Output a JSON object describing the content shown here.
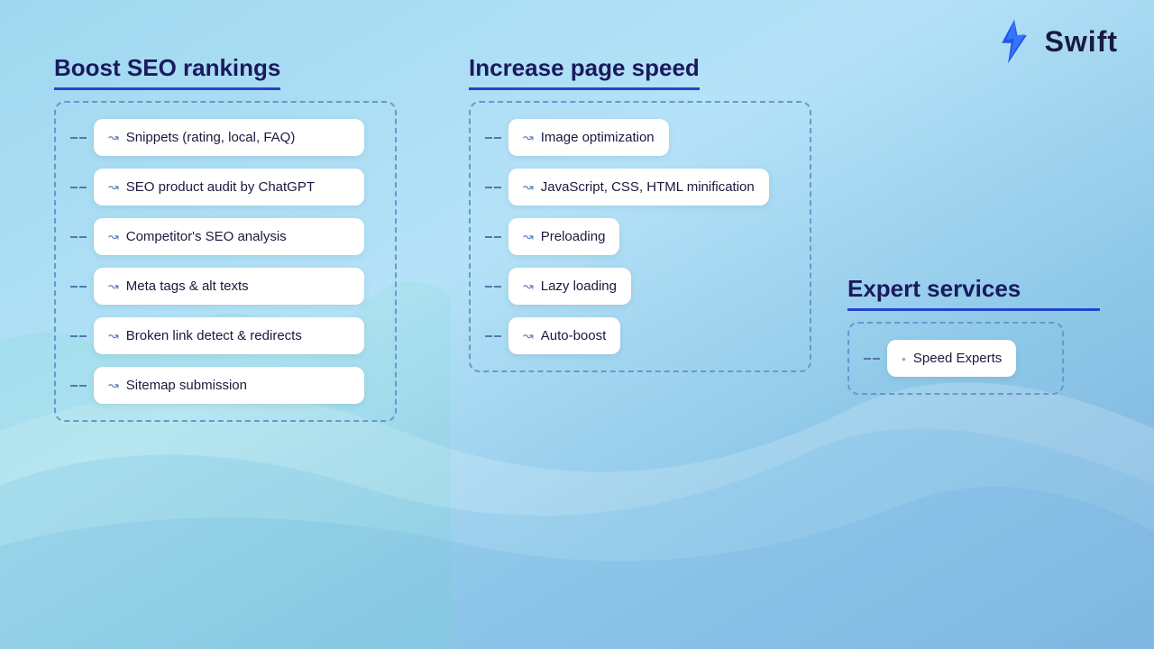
{
  "logo": {
    "text": "Swift"
  },
  "column1": {
    "title": "Boost SEO rankings",
    "items": [
      {
        "label": "Snippets (rating, local, FAQ)"
      },
      {
        "label": "SEO product audit by ChatGPT"
      },
      {
        "label": "Competitor's SEO analysis"
      },
      {
        "label": "Meta tags & alt texts"
      },
      {
        "label": "Broken link detect & redirects"
      },
      {
        "label": "Sitemap submission"
      }
    ]
  },
  "column2": {
    "title": "Increase page speed",
    "items": [
      {
        "label": "Image optimization"
      },
      {
        "label": "JavaScript, CSS, HTML minification"
      },
      {
        "label": "Preloading"
      },
      {
        "label": "Lazy loading"
      },
      {
        "label": "Auto-boost"
      }
    ]
  },
  "column3": {
    "title": "Expert services",
    "items": [
      {
        "label": "Speed Experts"
      }
    ]
  }
}
